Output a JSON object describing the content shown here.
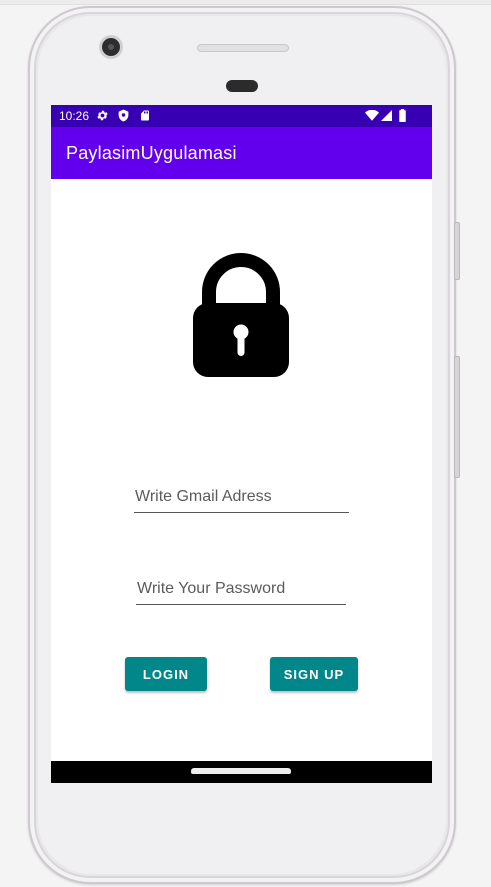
{
  "status_bar": {
    "time": "10:26",
    "left_icons": [
      "gear-icon",
      "shield-icon",
      "sd-card-icon"
    ],
    "right_icons": [
      "wifi-icon",
      "signal-icon",
      "battery-icon"
    ]
  },
  "app_bar": {
    "title": "PaylasimUygulamasi"
  },
  "login_form": {
    "email_placeholder": "Write Gmail Adress",
    "password_placeholder": "Write Your Password",
    "login_label": "LOGIN",
    "signup_label": "SIGN UP"
  },
  "colors": {
    "status_bar": "#3700b3",
    "app_bar": "#6200ee",
    "button": "#01878a"
  },
  "icons": {
    "hero": "lock-icon"
  }
}
